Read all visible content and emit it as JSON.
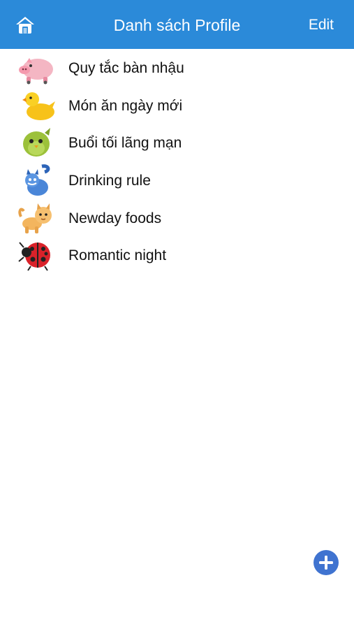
{
  "nav": {
    "title": "Danh sách Profile",
    "edit_label": "Edit",
    "home_icon": "home-icon",
    "color": "#2b8ad9"
  },
  "profiles": [
    {
      "label": "Quy tắc bàn nhậu",
      "icon": "pig-icon"
    },
    {
      "label": "Món ăn ngày mới",
      "icon": "duck-icon"
    },
    {
      "label": "Buổi tối lãng mạn",
      "icon": "bird-icon"
    },
    {
      "label": "Drinking rule",
      "icon": "cat-icon"
    },
    {
      "label": "Newday foods",
      "icon": "kitten-icon"
    },
    {
      "label": "Romantic night",
      "icon": "ladybug-icon"
    }
  ],
  "fab": {
    "icon": "add-icon",
    "color": "#3f73d0"
  }
}
